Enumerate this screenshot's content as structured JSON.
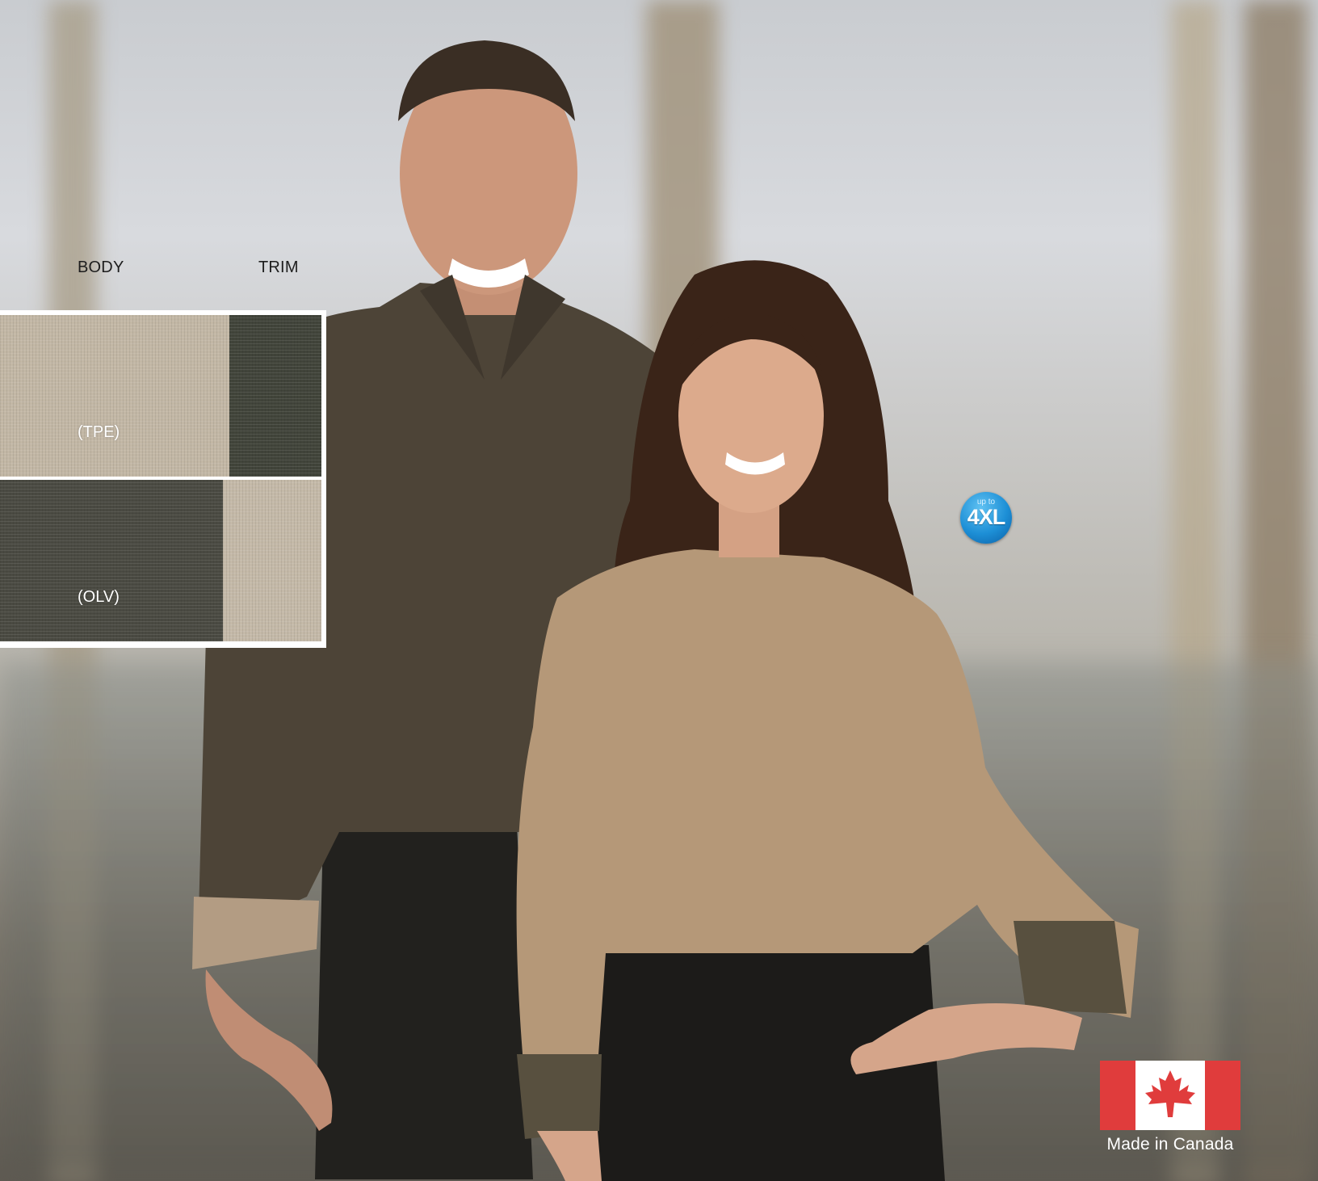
{
  "swatch_header": {
    "body_label": "BODY",
    "trim_label": "TRIM"
  },
  "swatches": [
    {
      "label": "(TPE)",
      "body_color": "#c2b7a5",
      "trim_color": "#41443a"
    },
    {
      "label": "(OLV)",
      "body_color": "#4a4a42",
      "trim_color": "#c4b9a8"
    }
  ],
  "badge": {
    "top_text": "up to",
    "main_text": "4XL",
    "color": "#1d8fd6"
  },
  "origin": {
    "caption": "Made in Canada",
    "flag_red": "#e03c3c",
    "flag_white": "#ffffff"
  }
}
